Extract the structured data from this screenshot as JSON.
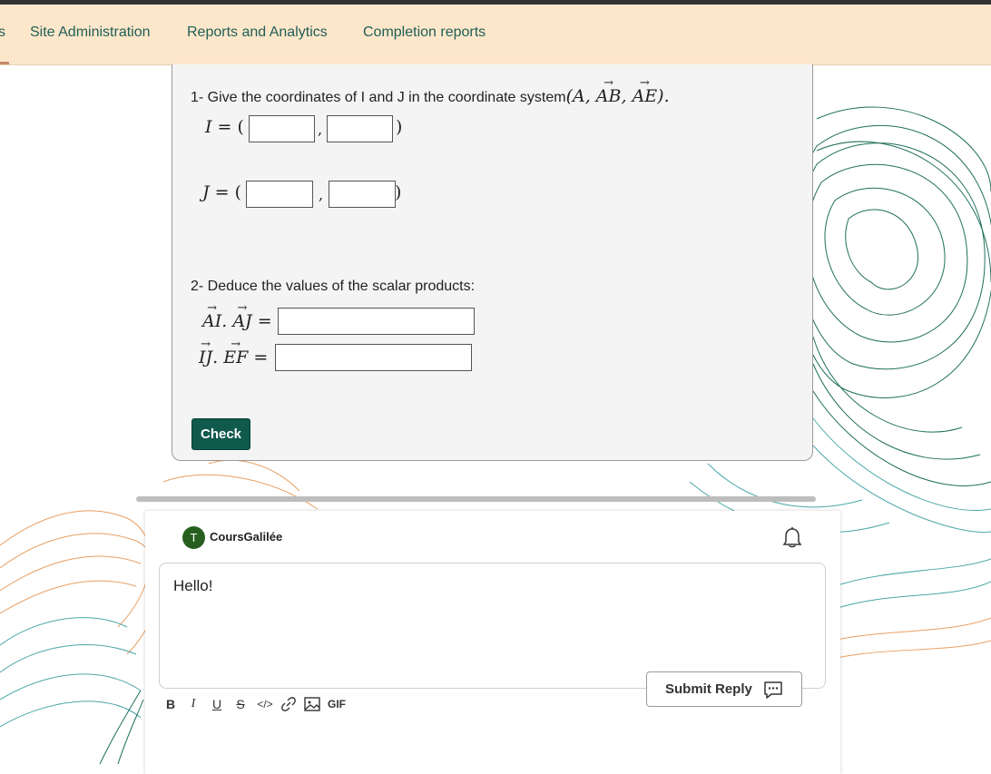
{
  "nav": {
    "items": [
      {
        "label": "s"
      },
      {
        "label": "Site Administration"
      },
      {
        "label": "Reports and Analytics"
      },
      {
        "label": "Completion reports"
      }
    ]
  },
  "quiz": {
    "q1_text": "1- Give the coordinates of I and J in the coordinate system",
    "q2_text": "2- Deduce the values of the scalar products:",
    "check_label": "Check",
    "inputs": {
      "i_x": "",
      "i_y": "",
      "j_x": "",
      "j_y": "",
      "ai_aj": "",
      "ij_ef": ""
    }
  },
  "reply": {
    "avatar_initial": "T",
    "username": "CoursGalilée",
    "editor_text": "Hello!",
    "submit_label": "Submit Reply",
    "toolbar": {
      "bold": "B",
      "italic": "I",
      "underline": "U",
      "strike": "S",
      "code": "</>",
      "gif": "GIF"
    }
  },
  "colors": {
    "nav_bg": "#fde7cb",
    "nav_text": "#1f5e57",
    "check_button": "#10594d",
    "avatar": "#275f1f"
  },
  "icons": [
    "bell-icon",
    "chat-bubble-icon",
    "link-icon",
    "image-icon"
  ]
}
